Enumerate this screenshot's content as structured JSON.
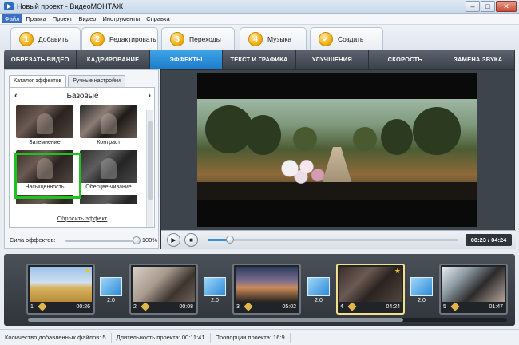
{
  "window": {
    "title": "Новый проект - ВидеоМОНТАЖ",
    "min": "–",
    "max": "□",
    "close": "✕"
  },
  "menu": [
    "Файл",
    "Правка",
    "Проект",
    "Видео",
    "Инструменты",
    "Справка"
  ],
  "steps": [
    {
      "num": "1",
      "label": "Добавить"
    },
    {
      "num": "2",
      "label": "Редактировать"
    },
    {
      "num": "3",
      "label": "Переходы"
    },
    {
      "num": "4",
      "label": "Музыка"
    },
    {
      "num": "✓",
      "label": "Создать"
    }
  ],
  "tabs": [
    "ОБРЕЗАТЬ ВИДЕО",
    "КАДРИРОВАНИЕ",
    "ЭФФЕКТЫ",
    "ТЕКСТ И ГРАФИКА",
    "УЛУЧШЕНИЯ",
    "СКОРОСТЬ",
    "ЗАМЕНА ЗВУКА"
  ],
  "active_tab": "ЭФФЕКТЫ",
  "left_panel": {
    "subtabs": [
      "Каталог эффектов",
      "Ручные настройки"
    ],
    "category": "Базовые",
    "prev": "‹",
    "next": "›",
    "effects": [
      "Затемнение",
      "Контраст",
      "Насыщенность",
      "Обесцве-чивание"
    ],
    "selected_effect": "Насыщенность",
    "reset": "Сбросить эффект",
    "strength_label": "Сила эффектов:",
    "strength_value": "100%"
  },
  "player": {
    "play_icon": "▶",
    "stop_icon": "■",
    "timecode": "00:23 / 04:24",
    "progress": 0.09
  },
  "clips": [
    {
      "num": "1",
      "duration": "00:26",
      "star": true
    },
    {
      "num": "2",
      "duration": "00:08",
      "star": false
    },
    {
      "num": "3",
      "duration": "05:02",
      "star": false
    },
    {
      "num": "4",
      "duration": "04:24",
      "star": true
    },
    {
      "num": "5",
      "duration": "01:47",
      "star": false
    }
  ],
  "transitions": [
    "2.0",
    "2.0",
    "2.0",
    "2.0"
  ],
  "status": {
    "files": "Количество добавленных файлов: 5",
    "duration": "Длительность проекта: 00:11:41",
    "aspect": "Пропорции проекта: 16:9"
  },
  "colors": {
    "accent": "#1d7ac8",
    "selection": "#1fc21f",
    "step_icon": "#f1b317"
  }
}
